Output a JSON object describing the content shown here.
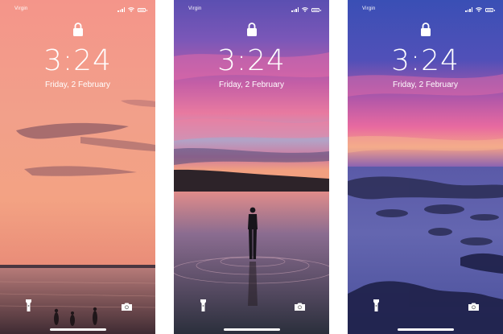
{
  "screens": [
    {
      "carrier": "Virgin",
      "time": "3:24",
      "date": "Friday, 2 February"
    },
    {
      "carrier": "Virgin",
      "time": "3:24",
      "date": "Friday, 2 February"
    },
    {
      "carrier": "Virgin",
      "time": "3:24",
      "date": "Friday, 2 February"
    }
  ],
  "icons": {
    "lock": "padlock-icon",
    "flashlight": "flashlight-icon",
    "camera": "camera-icon",
    "signal": "cellular-signal-icon",
    "wifi": "wifi-icon",
    "battery": "battery-icon"
  },
  "colors": {
    "screen1_sky": "#f0907a",
    "screen2_sky": "#7a5cc0",
    "screen3_sky": "#3d4fb8"
  }
}
